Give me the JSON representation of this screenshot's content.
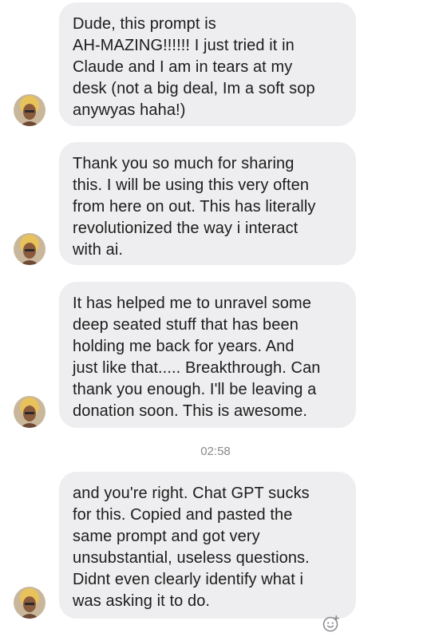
{
  "messages": [
    {
      "text": "Dude, this prompt is\nAH-MAZING!!!!!! I just tried it in\nClaude and I am in tears at my\ndesk (not a big deal, Im a soft sop\nanywyas haha!)"
    },
    {
      "text": "Thank you so much for sharing\nthis. I will be using this very often\nfrom here on out. This has literally\nrevolutionized the way i interact\nwith ai."
    },
    {
      "text": "It has helped me to unravel some\ndeep seated stuff that has been\nholding me back for years. And\njust like that..... Breakthrough. Can\nthank you enough. I'll be leaving a\ndonation soon. This is awesome."
    },
    {
      "text": "and you're right. Chat GPT sucks\nfor this. Copied and pasted the\nsame prompt and got very\nunsubstantial, useless questions.\nDidnt even clearly identify what i\nwas asking it to do."
    }
  ],
  "timestamp": "02:58",
  "icons": {
    "avatar": "avatar-photo",
    "reaction": "add-reaction-icon"
  },
  "colors": {
    "bubble": "#eeeef0",
    "text": "#1c1c1c",
    "timestamp": "#8a8a8a",
    "icon": "#8e8e93"
  }
}
